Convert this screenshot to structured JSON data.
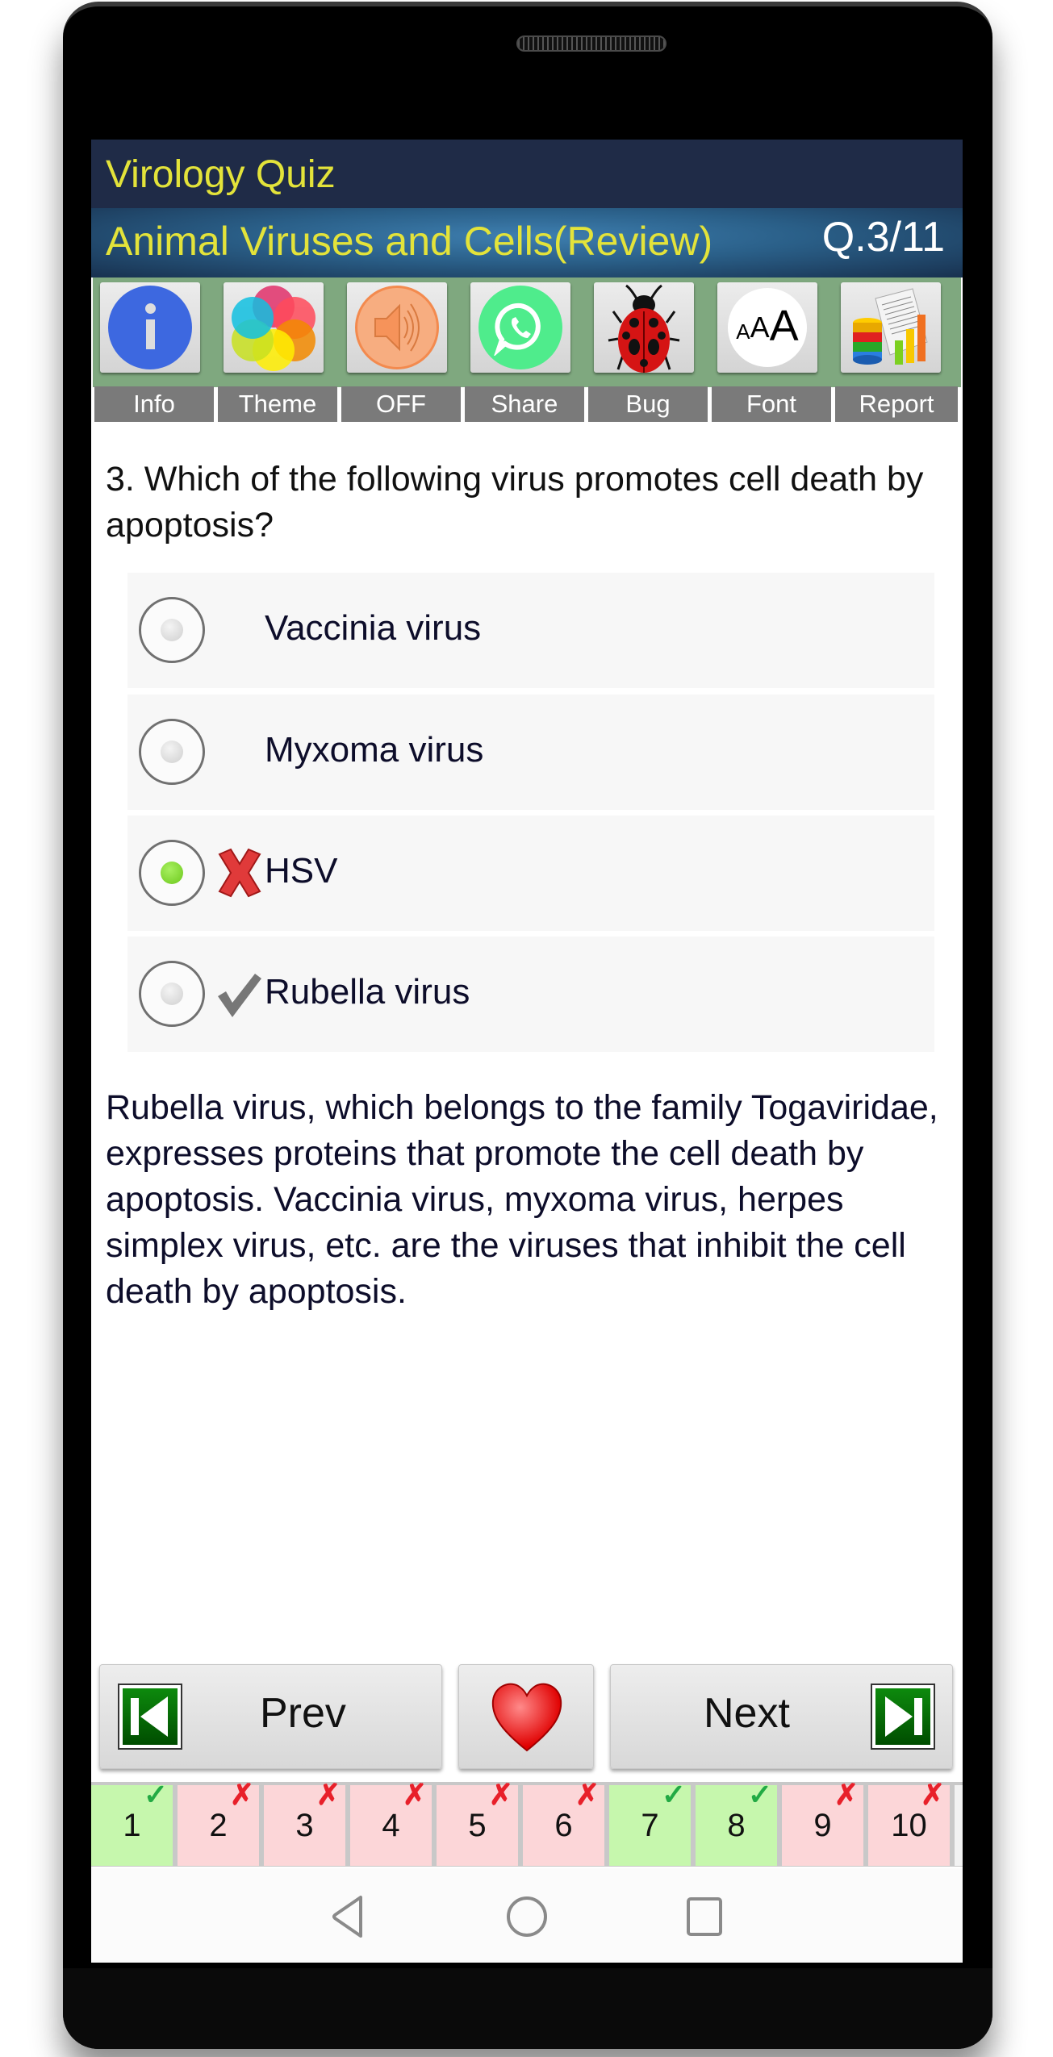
{
  "header": {
    "app_title": "Virology Quiz",
    "subtitle": "Animal Viruses and Cells(Review)",
    "question_counter": "Q.3/11"
  },
  "toolbar": {
    "items": [
      {
        "label": "Info",
        "icon": "info-icon"
      },
      {
        "label": "Theme",
        "icon": "theme-palette-icon"
      },
      {
        "label": "OFF",
        "icon": "speaker-icon"
      },
      {
        "label": "Share",
        "icon": "whatsapp-icon"
      },
      {
        "label": "Bug",
        "icon": "ladybug-icon"
      },
      {
        "label": "Font",
        "icon": "font-size-icon"
      },
      {
        "label": "Report",
        "icon": "report-chart-icon"
      }
    ],
    "font_icon_text": "AAA"
  },
  "question": {
    "text": "3. Which of the following virus promotes cell death by apoptosis?",
    "options": [
      {
        "text": "Vaccinia virus",
        "selected": false,
        "mark": "none"
      },
      {
        "text": "Myxoma virus",
        "selected": false,
        "mark": "none"
      },
      {
        "text": "HSV",
        "selected": true,
        "mark": "wrong"
      },
      {
        "text": "Rubella virus",
        "selected": false,
        "mark": "correct"
      }
    ],
    "explanation": "Rubella virus, which belongs to the family Togaviridae, expresses proteins that promote the cell death by apoptosis. Vaccinia virus, myxoma virus, herpes simplex virus, etc. are the viruses that inhibit the cell death by apoptosis."
  },
  "navigation": {
    "prev_label": "Prev",
    "next_label": "Next",
    "favorite_icon": "heart-icon"
  },
  "question_strip": [
    {
      "number": "1",
      "status": "correct",
      "mark": "✓"
    },
    {
      "number": "2",
      "status": "wrong",
      "mark": "✗"
    },
    {
      "number": "3",
      "status": "wrong",
      "mark": "✗"
    },
    {
      "number": "4",
      "status": "wrong",
      "mark": "✗"
    },
    {
      "number": "5",
      "status": "wrong",
      "mark": "✗"
    },
    {
      "number": "6",
      "status": "wrong",
      "mark": "✗"
    },
    {
      "number": "7",
      "status": "correct",
      "mark": "✓"
    },
    {
      "number": "8",
      "status": "correct",
      "mark": "✓"
    },
    {
      "number": "9",
      "status": "wrong",
      "mark": "✗"
    },
    {
      "number": "10",
      "status": "wrong",
      "mark": "✗"
    }
  ],
  "colors": {
    "title_yellow": "#e3e33a",
    "header_dark": "#1f2b47",
    "toolbar_green": "#7fa87f",
    "correct_bg": "#c6f7ad",
    "wrong_bg": "#fcd6d8",
    "correct_mark": "#22aa44",
    "wrong_mark": "#e8202a"
  }
}
